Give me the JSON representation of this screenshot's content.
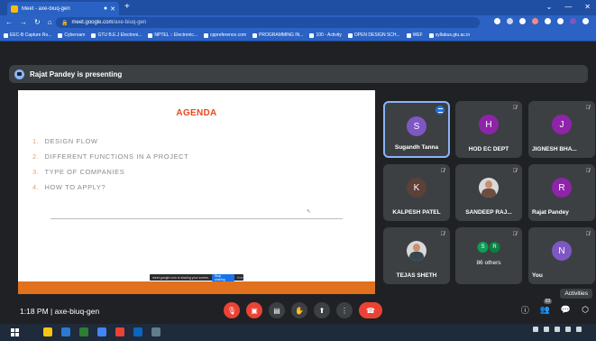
{
  "browser": {
    "tab_title": "Meet - axe-biuq-gen",
    "new_tab_symbol": "+",
    "url_host": "meet.google.com",
    "url_path": "/axe-biuq-gen",
    "window_controls": [
      "⌄",
      "—",
      "✕"
    ],
    "bookmarks": [
      "EEC-B Capture Ro...",
      "Cyberoam",
      "GTU B.E.J Electroni...",
      "NPTEL :: Electronic...",
      "cppreference.com",
      "PROGRAMMING IN...",
      "100 - Activity",
      "OPEN DESIGN SCH...",
      "WEF",
      "syllabus.gtu.ac.in"
    ]
  },
  "presenting": {
    "text": "Rajat Pandey is presenting"
  },
  "slide": {
    "title": "AGENDA",
    "items": [
      {
        "num": "1.",
        "text": "DESIGN FLOW"
      },
      {
        "num": "2.",
        "text": "DIFFERENT FUNCTIONS IN A PROJECT"
      },
      {
        "num": "3.",
        "text": "TYPE OF COMPANIES"
      },
      {
        "num": "4.",
        "text": "HOW TO APPLY?"
      }
    ],
    "share_bar_text": "meet.google.com is sharing your screen.",
    "share_stop": "Stop sharing",
    "share_hide": "Hide"
  },
  "participants": [
    {
      "name": "Sugandh Tanna",
      "initial": "S",
      "color": "#7e57c2"
    },
    {
      "name": "HOD EC DEPT",
      "initial": "H",
      "color": "#8e24aa"
    },
    {
      "name": "JIGNESH BHA...",
      "initial": "J",
      "color": "#8e24aa"
    },
    {
      "name": "KALPESH PATEL",
      "initial": "K",
      "color": "#5d4037"
    },
    {
      "name": "SANDEEP RAJ...",
      "initial": "",
      "color": "#d9d9d9"
    },
    {
      "name": "Rajat Pandey",
      "initial": "R",
      "color": "#8e24aa"
    },
    {
      "name": "TEJAS SHETH",
      "initial": "",
      "color": "#d9d9d9"
    },
    {
      "name": "86 others",
      "initial": "",
      "color": "#3c4043"
    },
    {
      "name": "You",
      "initial": "N",
      "color": "#7e57c2"
    }
  ],
  "others_avatars": [
    {
      "initial": "S",
      "color": "#0f9d58"
    },
    {
      "initial": "R",
      "color": "#0b8043"
    }
  ],
  "footer": {
    "meeting_info": "1:18 PM | axe-biuq-gen",
    "people_count": "93",
    "activities_tooltip": "Activities"
  },
  "colors": {
    "agenda_title": "#e8481c",
    "slide_footer": "#e2711d",
    "end_call": "#ea4335",
    "active_border": "#8ab4f8"
  }
}
